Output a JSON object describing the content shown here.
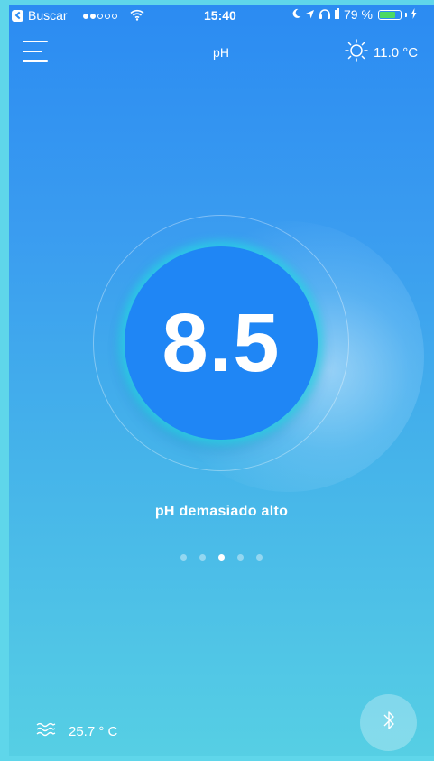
{
  "status_bar": {
    "back_label": "Buscar",
    "time": "15:40",
    "battery_text": "79 %",
    "battery_level": 0.79,
    "signal_bars_filled": 2,
    "signal_bars_total": 5
  },
  "nav": {
    "title": "pH",
    "temperature": "11.0 °C"
  },
  "reading": {
    "ph_value": "8.5",
    "status": "pH demasiado alto"
  },
  "pager": {
    "count": 5,
    "active_index": 2
  },
  "footer": {
    "water_temperature": "25.7 ° C"
  },
  "icons": {
    "menu": "hamburger-menu-icon",
    "weather": "sun-icon",
    "water": "water-waves-icon",
    "bluetooth": "bluetooth-icon"
  },
  "colors": {
    "accent": "#1f86f5",
    "ring_glow": "#28d7e6",
    "battery": "#4cd964"
  }
}
